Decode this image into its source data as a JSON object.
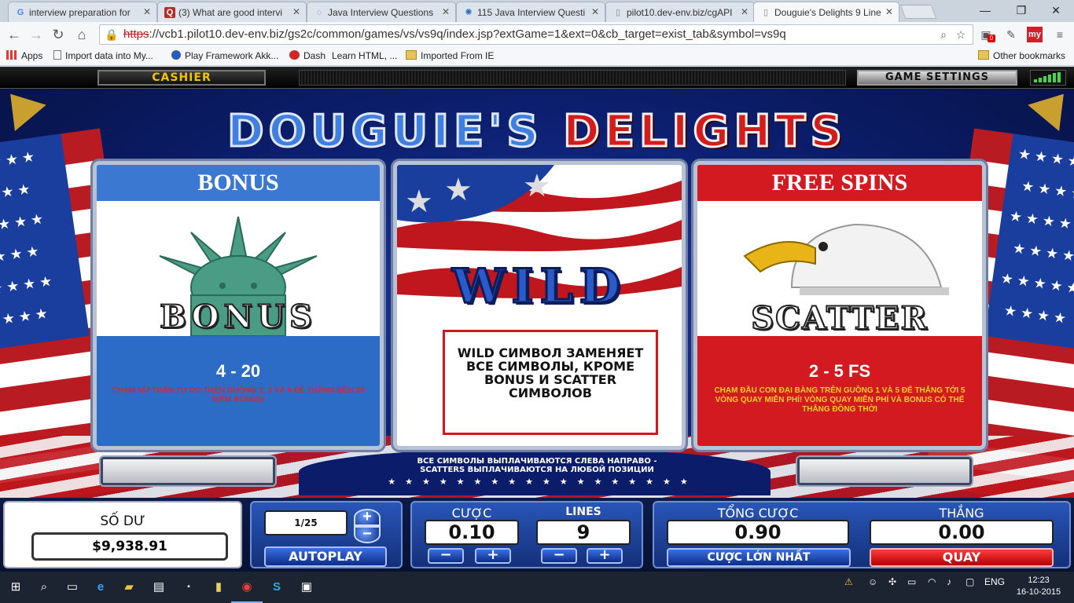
{
  "browser": {
    "tabs": [
      {
        "title": "interview preparation for",
        "icon": "google-icon"
      },
      {
        "title": "(3) What are good intervi",
        "icon": "quora-icon"
      },
      {
        "title": "Java Interview Questions",
        "icon": "loading-icon"
      },
      {
        "title": "115 Java Interview Questi",
        "icon": "site-icon"
      },
      {
        "title": "pilot10.dev-env.biz/cgAPI",
        "icon": "page-icon"
      },
      {
        "title": "Douguie's Delights 9 Line",
        "icon": "page-icon"
      }
    ],
    "url_scheme": "https",
    "url_rest": "://vcb1.pilot10.dev-env.biz/gs2c/common/games/vs/vs9q/index.jsp?extGame=1&ext=0&cb_target=exist_tab&symbol=vs9q",
    "bookmarks": [
      "Apps",
      "Import data into My...",
      "Play Framework Akk...",
      "Dash",
      "Learn HTML, ...",
      "Imported From IE"
    ],
    "other_bookmarks": "Other bookmarks",
    "extension_badge": "0",
    "ext_my": "my"
  },
  "game": {
    "cashier_label": "CASHIER",
    "settings_label": "GAME SETTINGS",
    "title_word1": "DOUGUIE'S",
    "title_word2": "DELIGHTS",
    "bonus": {
      "header": "BONUS",
      "symbol_text": "BONUS",
      "amount": "4 - 20",
      "desc": "CHẠM NỮ THẦN TỰ DO TRÊN GUỒNG 2, 3 VÀ 4 ĐỂ THẮNG ĐẾN 20 ĐIỂM BONUS!"
    },
    "wild": {
      "symbol_text": "WILD",
      "desc": "WILD СИМВОЛ ЗАМЕНЯЕТ ВСЕ СИМВОЛЫ, КРОМЕ BONUS И SCATTER СИМВОЛОВ"
    },
    "free_spins": {
      "header": "FREE SPINS",
      "symbol_text": "SCATTER",
      "amount": "2 - 5 FS",
      "desc": "CHẠM ĐẦU CON ĐẠI BÀNG TRÊN GUỒNG 1 VÀ 5 ĐỂ THẮNG TỚI 5 VÒNG QUAY MIỄN PHÍ! VÒNG QUAY MIỄN PHÍ VÀ BONUS CÓ THỂ THẮNG ĐỒNG THỜI"
    },
    "pays_line1": "ВСЕ СИМВОЛЫ ВЫПЛАЧИВАЮТСЯ СЛЕВА НАПРАВО -",
    "pays_line2": "SCATTERS ВЫПЛАЧИВАЮТСЯ НА ЛЮБОЙ ПОЗИЦИИ",
    "page_indicator": "1/25",
    "autoplay_label": "AUTOPLAY",
    "balance_label": "SỐ DƯ",
    "balance_value": "$9,938.91",
    "bet_label": "CƯỢC",
    "bet_value": "0.10",
    "lines_label": "LINES",
    "lines_value": "9",
    "total_bet_label": "TỔNG CƯỢC",
    "total_bet_value": "0.90",
    "max_bet_label": "CƯỢC LỚN NHẤT",
    "win_label": "THẮNG",
    "win_value": "0.00",
    "spin_label": "QUAY"
  },
  "taskbar": {
    "lang": "ENG",
    "time": "12:23",
    "date": "16-10-2015"
  }
}
